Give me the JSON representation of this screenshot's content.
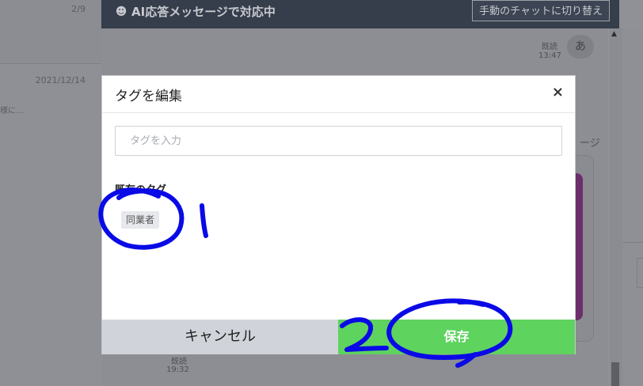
{
  "conversation_list": {
    "items": [
      {
        "date": "2/9"
      },
      {
        "date": "2021/12/14",
        "snippet": "様に…"
      }
    ]
  },
  "chat_header": {
    "icon": "bot-icon",
    "title": "AI応答メッセージで対応中",
    "switch_button": "手動のチャットに切り替え"
  },
  "messages": {
    "top_read": "既読",
    "top_time": "13:47",
    "avatar_char": "あ",
    "side_text": "ージ",
    "bottom_read": "既読",
    "bottom_time": "19:32"
  },
  "modal": {
    "title": "タグを編集",
    "close": "×",
    "input_placeholder": "タグを入力",
    "input_value": "",
    "existing_tags_label": "既存のタグ",
    "tags": [
      "同業者"
    ],
    "cancel": "キャンセル",
    "save": "保存"
  },
  "annotations": {
    "color": "#0a0ae6",
    "labels": [
      "1",
      "2"
    ]
  },
  "colors": {
    "header_bg": "#363d4b",
    "save_green": "#5ed35e",
    "cancel_gray": "#d0d4da",
    "overlay": "#8f9197"
  }
}
